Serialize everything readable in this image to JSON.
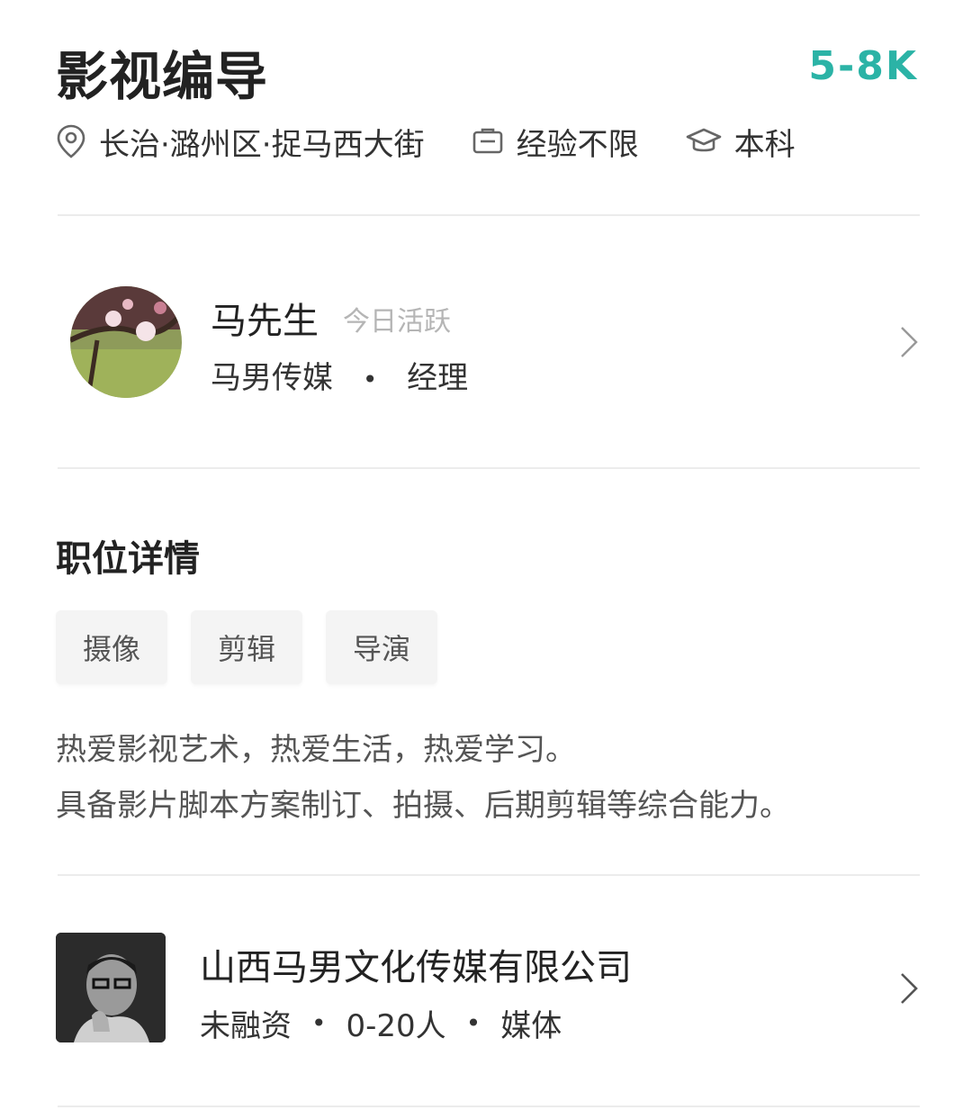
{
  "job": {
    "title": "影视编导",
    "salary": "5-8K",
    "location": "长治·潞州区·捉马西大街",
    "experience": "经验不限",
    "education": "本科",
    "icons": {
      "location": "location-pin-icon",
      "experience": "briefcase-icon",
      "education": "graduation-cap-icon"
    }
  },
  "boss": {
    "name": "马先生",
    "active_status": "今日活跃",
    "company": "马男传媒",
    "separator": "•",
    "position": "经理"
  },
  "details": {
    "section_title": "职位详情",
    "tags": [
      "摄像",
      "剪辑",
      "导演"
    ],
    "description": [
      "热爱影视艺术，热爱生活，热爱学习。",
      "具备影片脚本方案制订、拍摄、后期剪辑等综合能力。"
    ]
  },
  "company": {
    "name": "山西马男文化传媒有限公司",
    "funding": "未融资",
    "size": "0-20人",
    "industry": "媒体",
    "separator": "•"
  },
  "colors": {
    "accent": "#2bb3a6",
    "muted": "#b5b5b5",
    "divider": "#ececec",
    "tag_bg": "#f4f4f4"
  }
}
